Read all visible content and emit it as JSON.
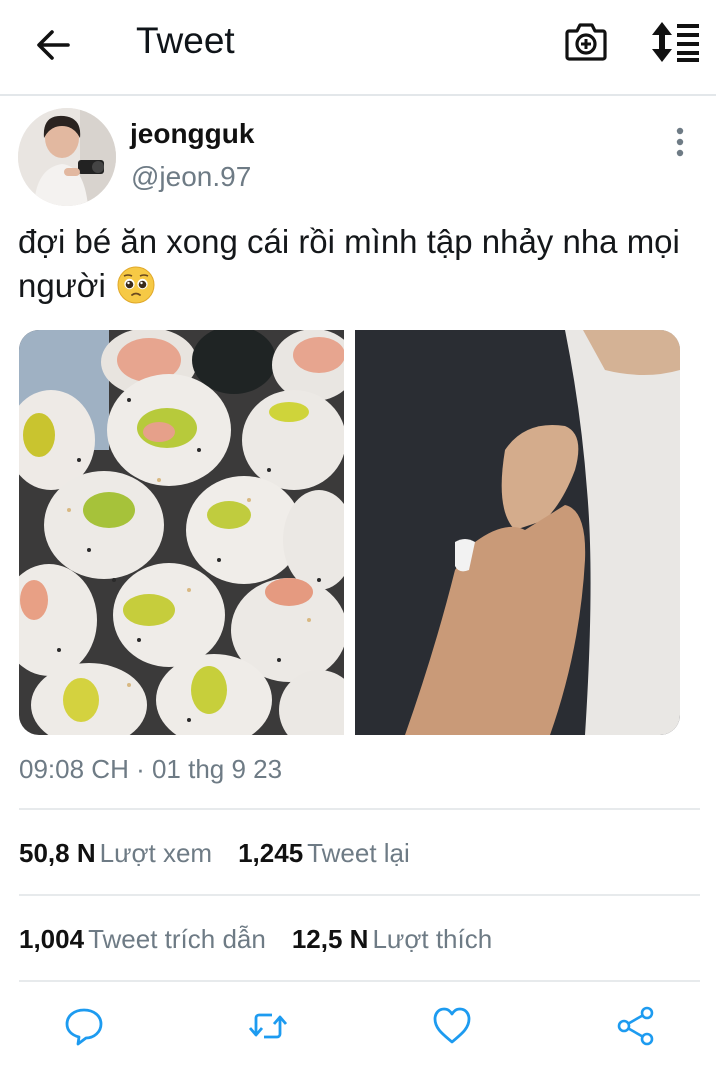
{
  "header": {
    "title": "Tweet",
    "back_icon": "arrow-left-icon",
    "camera_icon": "camera-icon",
    "sort_icon": "sort-icon"
  },
  "author": {
    "name": "jeongguk",
    "handle": "@jeon.97"
  },
  "tweet": {
    "text": "đợi bé ăn xong cái rồi mình tập nhảy nha mọi người",
    "emoji_icon": "pleading-face-icon",
    "timestamp": "09:08 CH · 01 thg 9 23"
  },
  "stats": {
    "views_count": "50,8 N",
    "views_label": "Lượt xem",
    "retweets_count": "1,245",
    "retweets_label": "Tweet lại",
    "quotes_count": "1,004",
    "quotes_label": "Tweet trích dẫn",
    "likes_count": "12,5 N",
    "likes_label": "Lượt thích"
  },
  "actions": [
    "reply-icon",
    "retweet-icon",
    "like-icon",
    "share-icon"
  ],
  "colors": {
    "secondary_text": "#6e7b85",
    "divider": "#e7eaec",
    "action_icon": "#1d9bf0"
  }
}
